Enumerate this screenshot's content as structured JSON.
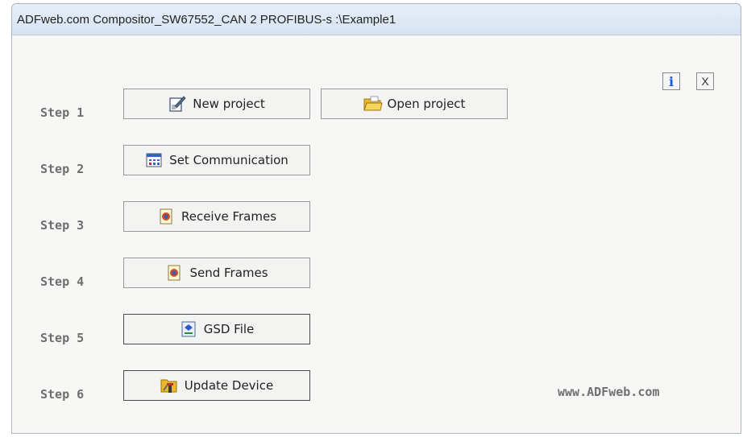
{
  "window": {
    "title": "ADFweb.com Compositor_SW67552_CAN 2 PROFIBUS-s :\\Example1"
  },
  "toolbar": {
    "info_label": "i",
    "close_label": "X"
  },
  "steps": [
    {
      "label": "Step 1"
    },
    {
      "label": "Step 2"
    },
    {
      "label": "Step 3"
    },
    {
      "label": "Step 4"
    },
    {
      "label": "Step 5"
    },
    {
      "label": "Step 6"
    }
  ],
  "buttons": {
    "new_project": {
      "label": "New project",
      "icon": "new-project-icon"
    },
    "open_project": {
      "label": "Open project",
      "icon": "folder-icon"
    },
    "set_communication": {
      "label": "Set Communication",
      "icon": "communication-icon"
    },
    "receive_frames": {
      "label": "Receive Frames",
      "icon": "frames-icon"
    },
    "send_frames": {
      "label": "Send Frames",
      "icon": "frames-icon"
    },
    "gsd_file": {
      "label": "GSD File",
      "icon": "gsd-file-icon"
    },
    "update_device": {
      "label": "Update Device",
      "icon": "update-device-icon"
    }
  },
  "footer": {
    "website": "www.ADFweb.com"
  },
  "colors": {
    "info_blue": "#1e5bd1",
    "step_gray": "#6e6e6e",
    "title_bar": "#dbe6f3"
  }
}
